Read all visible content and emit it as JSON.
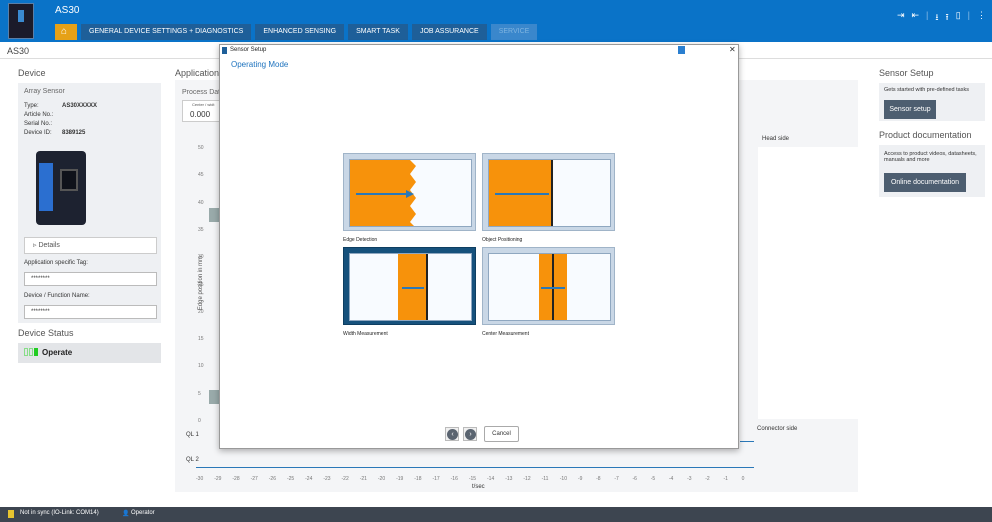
{
  "window": {
    "title": "AS30",
    "breadcrumb": "AS30"
  },
  "nav": {
    "tabs": [
      "GENERAL DEVICE SETTINGS + DIAGNOSTICS",
      "ENHANCED SENSING",
      "SMART TASK",
      "JOB ASSURANCE",
      "SERVICE"
    ],
    "home_icon": "home-icon"
  },
  "device": {
    "heading": "Device",
    "name": "Array Sensor",
    "type_label": "Type:",
    "type": "AS30XXXXX",
    "article_label": "Article No.:",
    "serial_label": "Serial No.:",
    "id_label": "Device ID:",
    "id": "8389125",
    "details": "Details",
    "tag_label": "Application specific Tag:",
    "tag_value": "********",
    "func_label": "Device / Function Name:",
    "func_value": "********",
    "status_heading": "Device Status",
    "status": "Operate"
  },
  "center": {
    "heading": "Application",
    "process": "Process Dat",
    "center_label": "Center / widt",
    "value": "0.000",
    "ylabel": "Edge position in mm",
    "head_side": "Head side",
    "connector_side": "Connector side",
    "ql1": "QL 1",
    "ql2": "QL 2",
    "xlabel": "t/sec",
    "yticks": [
      "50",
      "45",
      "40",
      "35",
      "30",
      "25",
      "20",
      "15",
      "10",
      "5",
      "0"
    ],
    "xticks": [
      "-30",
      "-29",
      "-28",
      "-27",
      "-26",
      "-25",
      "-24",
      "-23",
      "-22",
      "-21",
      "-20",
      "-19",
      "-18",
      "-17",
      "-16",
      "-15",
      "-14",
      "-13",
      "-12",
      "-11",
      "-10",
      "-9",
      "-8",
      "-7",
      "-6",
      "-5",
      "-4",
      "-3",
      "-2",
      "-1",
      "0"
    ]
  },
  "right": {
    "setup_heading": "Sensor Setup",
    "setup_text": "Gets started with pre-defined tasks",
    "setup_button": "Sensor setup",
    "doc_heading": "Product documentation",
    "doc_text": "Access to product videos, datasheets, manuals and more",
    "doc_button": "Online documentation"
  },
  "modal": {
    "title": "Sensor Setup",
    "subtitle": "Operating Mode",
    "modes": [
      "Edge Detection",
      "Object Positioning",
      "Width Measurement",
      "Center Measurement"
    ],
    "selected": "Width Measurement",
    "cancel": "Cancel"
  },
  "footer": {
    "sync": "Not in sync (IO-Link: COM14)",
    "user": "Operator"
  },
  "colors": {
    "brand": "#0a73c8",
    "accent": "#f7920b",
    "selected": "#16517c"
  }
}
